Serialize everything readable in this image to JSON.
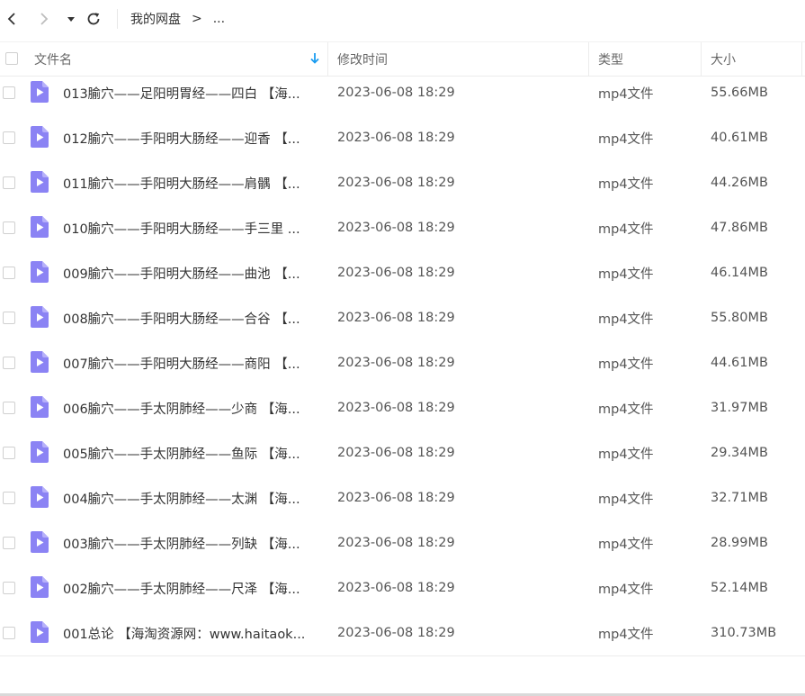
{
  "toolbar": {
    "back_icon": "chevron-left-icon",
    "forward_icon": "chevron-right-icon",
    "history_icon": "caret-down-icon",
    "refresh_icon": "refresh-icon"
  },
  "breadcrumb": {
    "root": "我的网盘",
    "separator": ">",
    "current": "..."
  },
  "columns": {
    "name": "文件名",
    "modified": "修改时间",
    "type": "类型",
    "size": "大小",
    "sort_icon": "arrow-down-icon"
  },
  "colors": {
    "accent": "#1a9cf0",
    "file_icon": "#8b83f4",
    "file_icon_fold": "#b7b1fa"
  },
  "files": [
    {
      "name": "013腧穴——足阳明胃经——四白 【海...",
      "modified": "2023-06-08 18:29",
      "type": "mp4文件",
      "size": "55.66MB"
    },
    {
      "name": "012腧穴——手阳明大肠经——迎香 【...",
      "modified": "2023-06-08 18:29",
      "type": "mp4文件",
      "size": "40.61MB"
    },
    {
      "name": "011腧穴——手阳明大肠经——肩髃 【...",
      "modified": "2023-06-08 18:29",
      "type": "mp4文件",
      "size": "44.26MB"
    },
    {
      "name": "010腧穴——手阳明大肠经——手三里 ...",
      "modified": "2023-06-08 18:29",
      "type": "mp4文件",
      "size": "47.86MB"
    },
    {
      "name": "009腧穴——手阳明大肠经——曲池 【...",
      "modified": "2023-06-08 18:29",
      "type": "mp4文件",
      "size": "46.14MB"
    },
    {
      "name": "008腧穴——手阳明大肠经——合谷 【...",
      "modified": "2023-06-08 18:29",
      "type": "mp4文件",
      "size": "55.80MB"
    },
    {
      "name": "007腧穴——手阳明大肠经——商阳 【...",
      "modified": "2023-06-08 18:29",
      "type": "mp4文件",
      "size": "44.61MB"
    },
    {
      "name": "006腧穴——手太阴肺经——少商 【海...",
      "modified": "2023-06-08 18:29",
      "type": "mp4文件",
      "size": "31.97MB"
    },
    {
      "name": "005腧穴——手太阴肺经——鱼际 【海...",
      "modified": "2023-06-08 18:29",
      "type": "mp4文件",
      "size": "29.34MB"
    },
    {
      "name": "004腧穴——手太阴肺经——太渊 【海...",
      "modified": "2023-06-08 18:29",
      "type": "mp4文件",
      "size": "32.71MB"
    },
    {
      "name": "003腧穴——手太阴肺经——列缺 【海...",
      "modified": "2023-06-08 18:29",
      "type": "mp4文件",
      "size": "28.99MB"
    },
    {
      "name": "002腧穴——手太阴肺经——尺泽 【海...",
      "modified": "2023-06-08 18:29",
      "type": "mp4文件",
      "size": "52.14MB"
    },
    {
      "name": "001总论 【海淘资源网：www.haitaok...",
      "modified": "2023-06-08 18:29",
      "type": "mp4文件",
      "size": "310.73MB"
    }
  ]
}
